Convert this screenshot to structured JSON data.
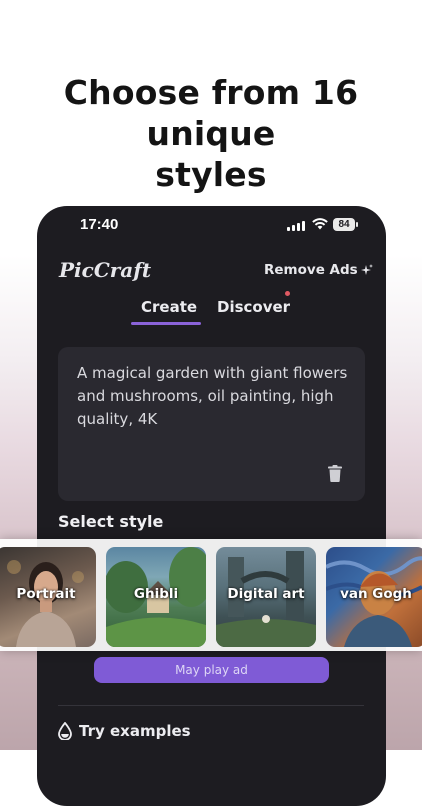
{
  "headline": {
    "line1": "Choose from 16 unique",
    "line2": "styles"
  },
  "status_bar": {
    "time": "17:40",
    "battery": "84"
  },
  "app": {
    "name": "PicCraft",
    "remove_ads": "Remove Ads"
  },
  "tabs": [
    {
      "label": "Create",
      "active": true
    },
    {
      "label": "Discover",
      "has_dot": true
    }
  ],
  "prompt": {
    "text": "A magical garden with giant flowers and mushrooms, oil painting, high quality, 4K"
  },
  "select_style_label": "Select style",
  "styles": [
    {
      "label": "Portrait"
    },
    {
      "label": "Ghibli"
    },
    {
      "label": "Digital art"
    },
    {
      "label": "van Gogh"
    }
  ],
  "ad_button": "May play ad",
  "try_examples": "Try examples",
  "colors": {
    "accent": "#7f5bd6",
    "tab_underline": "#8b63d9",
    "notification_dot": "#e05a63",
    "panel_bg": "#1d1c21"
  }
}
